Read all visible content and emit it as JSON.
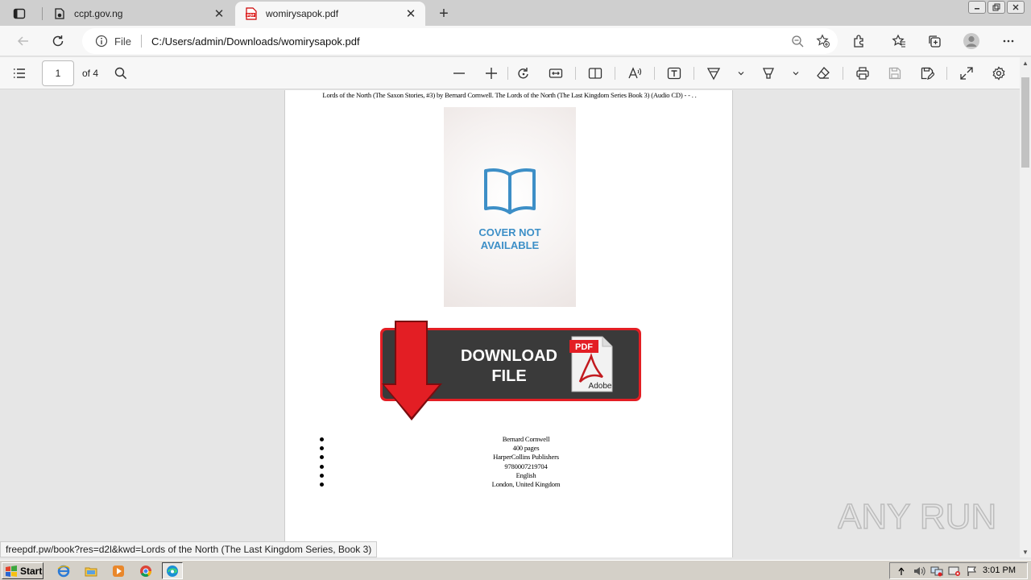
{
  "browser": {
    "tabs": [
      {
        "title": "ccpt.gov.ng",
        "active": false
      },
      {
        "title": "womirysapok.pdf",
        "active": true
      }
    ],
    "address": {
      "scheme": "File",
      "url": "C:/Users/admin/Downloads/womirysapok.pdf"
    }
  },
  "pdf_toolbar": {
    "page_number": "1",
    "page_count": "of 4"
  },
  "document": {
    "header_line": "Lords of the North (The Saxon Stories, #3) by Bernard Cornwell. The Lords of the North (The Last Kingdom Series Book 3) (Audio CD) - - . .",
    "cover_text_line1": "COVER NOT",
    "cover_text_line2": "AVAILABLE",
    "download_line1": "DOWNLOAD",
    "download_line2": "FILE",
    "pdf_badge": "PDF",
    "adobe_label": "Adobe",
    "details": [
      "Bernard Cornwell",
      "400 pages",
      "HarperCollins Publishers",
      "9780007219704",
      "English",
      "London, United Kingdom"
    ]
  },
  "status_link": "freepdf.pw/book?res=d2l&kwd=Lords of the North (The Last Kingdom Series, Book 3)",
  "watermark": "ANY RUN",
  "taskbar": {
    "start_label": "Start",
    "clock": "3:01 PM"
  },
  "colors": {
    "download_red": "#e31e24",
    "download_dark": "#3a3a3a",
    "cover_blue": "#3d8fc7"
  }
}
